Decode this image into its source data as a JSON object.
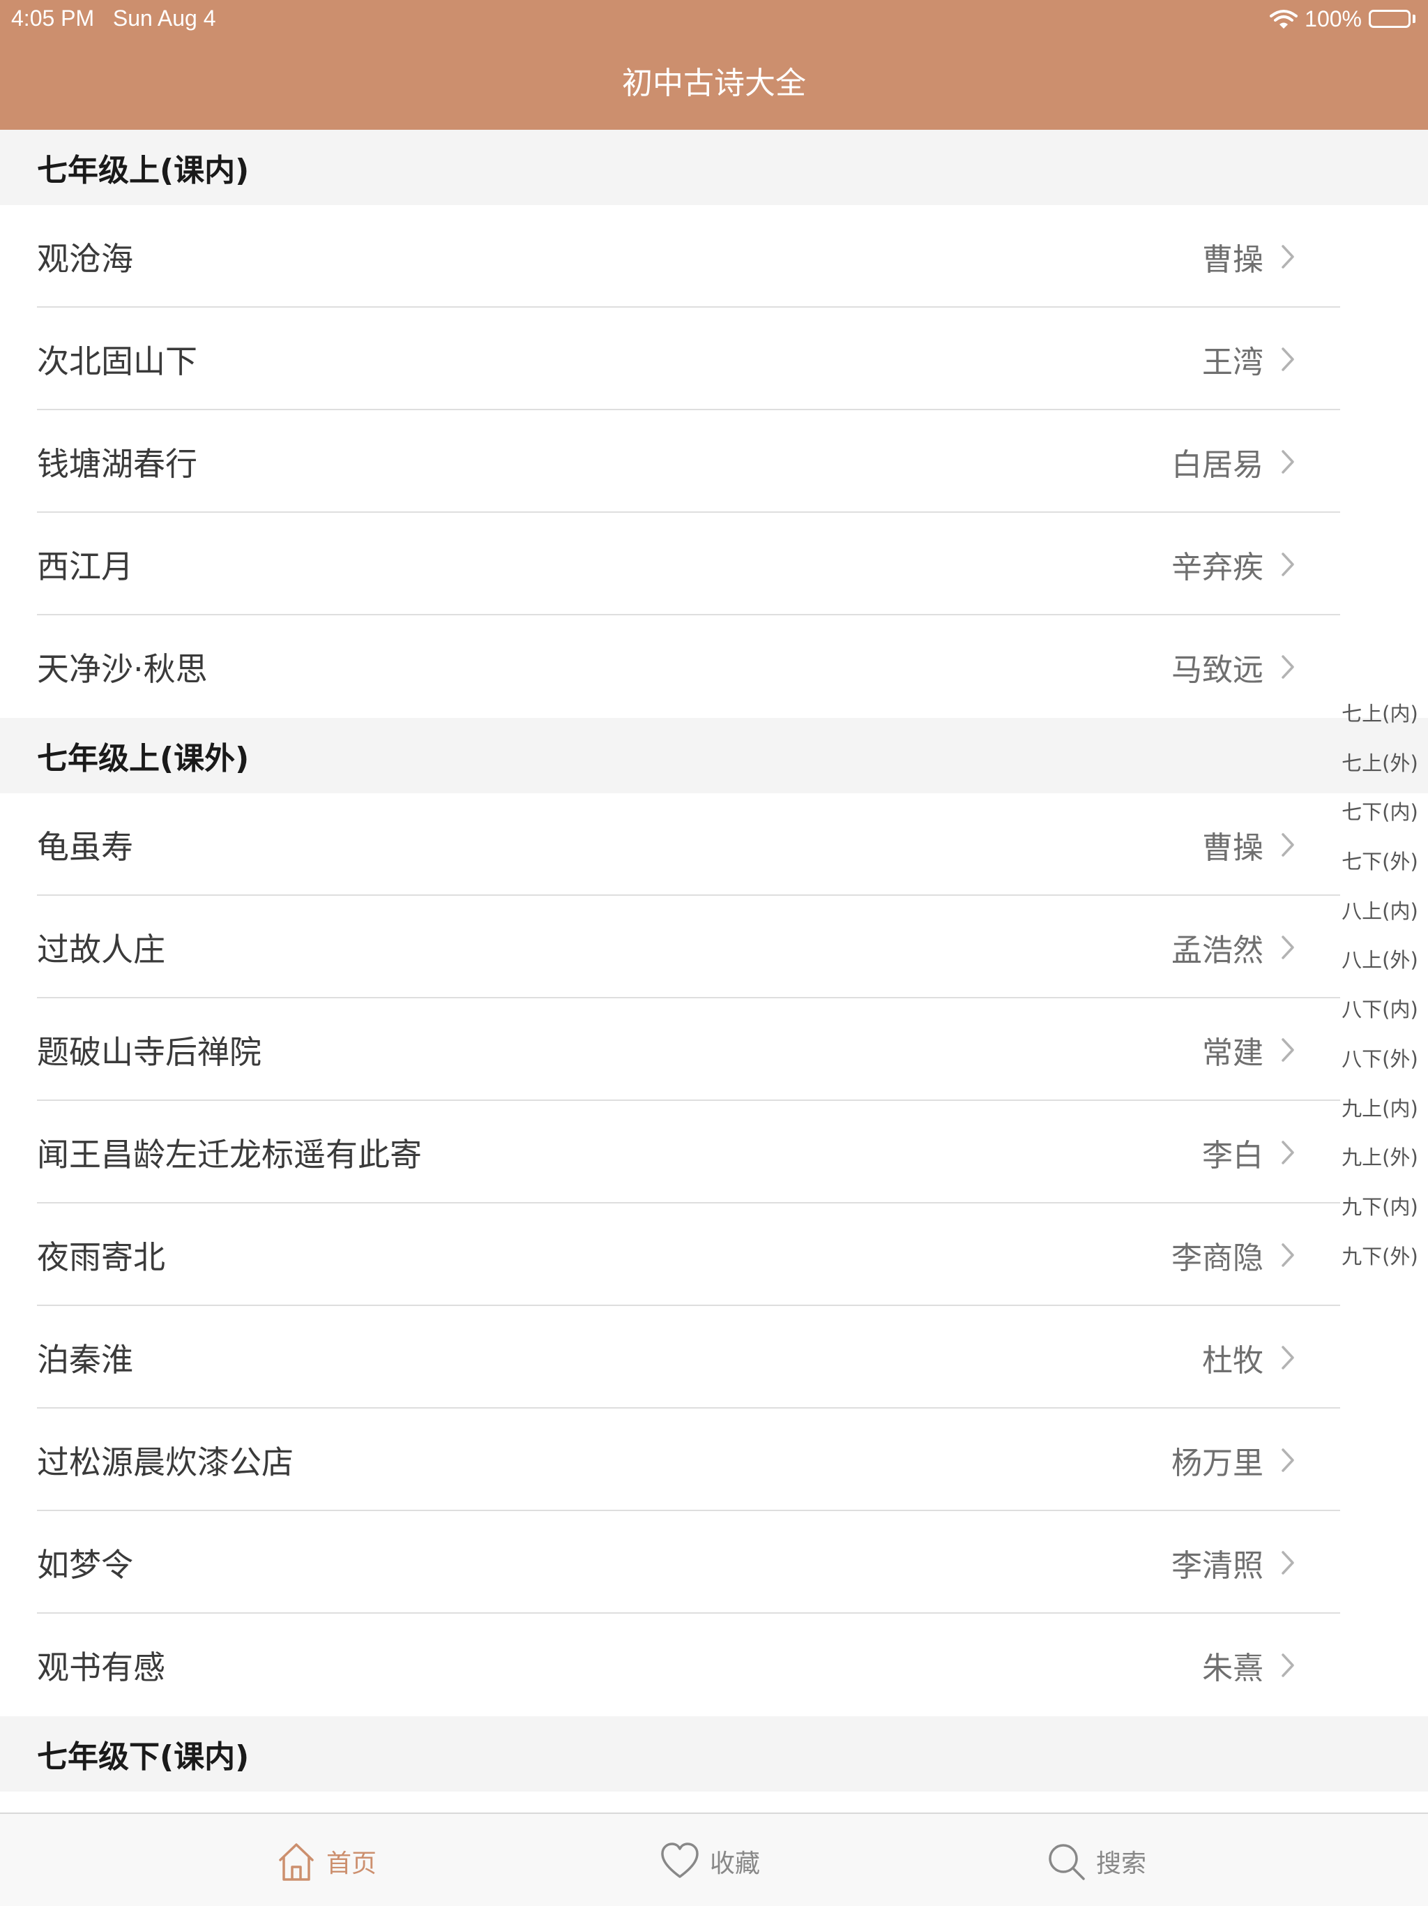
{
  "status_bar": {
    "time": "4:05 PM",
    "date": "Sun Aug 4",
    "battery": "100%"
  },
  "nav": {
    "title": "初中古诗大全"
  },
  "sections": [
    {
      "title": "七年级上(课内)",
      "items": [
        {
          "title": "观沧海",
          "author": "曹操"
        },
        {
          "title": "次北固山下",
          "author": "王湾"
        },
        {
          "title": "钱塘湖春行",
          "author": "白居易"
        },
        {
          "title": "西江月",
          "author": "辛弃疾"
        },
        {
          "title": "天净沙·秋思",
          "author": "马致远"
        }
      ]
    },
    {
      "title": "七年级上(课外)",
      "items": [
        {
          "title": "龟虽寿",
          "author": "曹操"
        },
        {
          "title": "过故人庄",
          "author": "孟浩然"
        },
        {
          "title": "题破山寺后禅院",
          "author": "常建"
        },
        {
          "title": "闻王昌龄左迁龙标遥有此寄",
          "author": "李白"
        },
        {
          "title": "夜雨寄北",
          "author": "李商隐"
        },
        {
          "title": "泊秦淮",
          "author": "杜牧"
        },
        {
          "title": "过松源晨炊漆公店",
          "author": "杨万里"
        },
        {
          "title": "如梦令",
          "author": "李清照"
        },
        {
          "title": "观书有感",
          "author": "朱熹"
        }
      ]
    },
    {
      "title": "七年级下(课内)",
      "items": []
    }
  ],
  "index_bar": [
    "七上(内)",
    "七上(外)",
    "七下(内)",
    "七下(外)",
    "八上(内)",
    "八上(外)",
    "八下(内)",
    "八下(外)",
    "九上(内)",
    "九上(外)",
    "九下(内)",
    "九下(外)"
  ],
  "tabs": [
    {
      "label": "首页",
      "icon": "home-icon",
      "active": true
    },
    {
      "label": "收藏",
      "icon": "heart-icon",
      "active": false
    },
    {
      "label": "搜索",
      "icon": "search-icon",
      "active": false
    }
  ],
  "colors": {
    "accent": "#cc8f6e",
    "section_bg": "#f4f4f4",
    "tab_inactive": "#888888"
  }
}
